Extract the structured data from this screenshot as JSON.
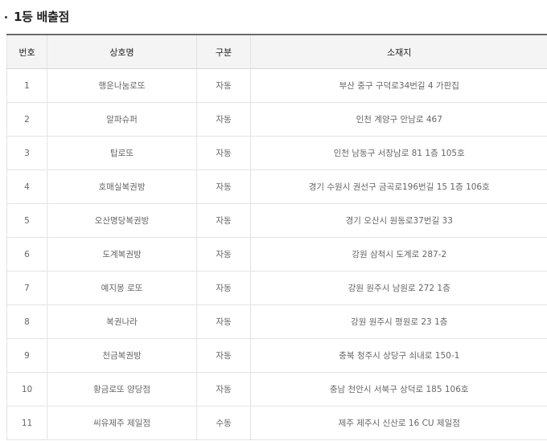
{
  "section": {
    "title": "1등 배출점"
  },
  "table": {
    "headers": {
      "no": "번호",
      "name": "상호명",
      "type": "구분",
      "address": "소재지"
    },
    "rows": [
      {
        "no": "1",
        "name": "행운나눔로또",
        "type": "자동",
        "address": "부산 중구 구덕로34번길 4 가판집"
      },
      {
        "no": "2",
        "name": "알파슈퍼",
        "type": "자동",
        "address": "인천 계양구 안남로 467"
      },
      {
        "no": "3",
        "name": "탑로또",
        "type": "자동",
        "address": "인천 남동구 서창남로 81 1층 105호"
      },
      {
        "no": "4",
        "name": "호매실복권방",
        "type": "자동",
        "address": "경기 수원시 권선구 금곡로196번길 15 1층 106호"
      },
      {
        "no": "5",
        "name": "오산명당복권방",
        "type": "자동",
        "address": "경기 오산시 원동로37번길 33"
      },
      {
        "no": "6",
        "name": "도계복권방",
        "type": "자동",
        "address": "강원 삼척시 도계로 287-2"
      },
      {
        "no": "7",
        "name": "예지몽 로또",
        "type": "자동",
        "address": "강원 원주시 남원로 272 1층"
      },
      {
        "no": "8",
        "name": "복권나라",
        "type": "자동",
        "address": "강원 원주시 평원로 23 1층"
      },
      {
        "no": "9",
        "name": "천금복권방",
        "type": "자동",
        "address": "충북 청주시 상당구 쇠내로 150-1"
      },
      {
        "no": "10",
        "name": "황금로또 양당점",
        "type": "자동",
        "address": "충남 천안시 서북구 상덕로 185 106호"
      },
      {
        "no": "11",
        "name": "씨유제주 제일점",
        "type": "수동",
        "address": "제주 제주시 신산로 16 CU 제일점"
      }
    ]
  }
}
